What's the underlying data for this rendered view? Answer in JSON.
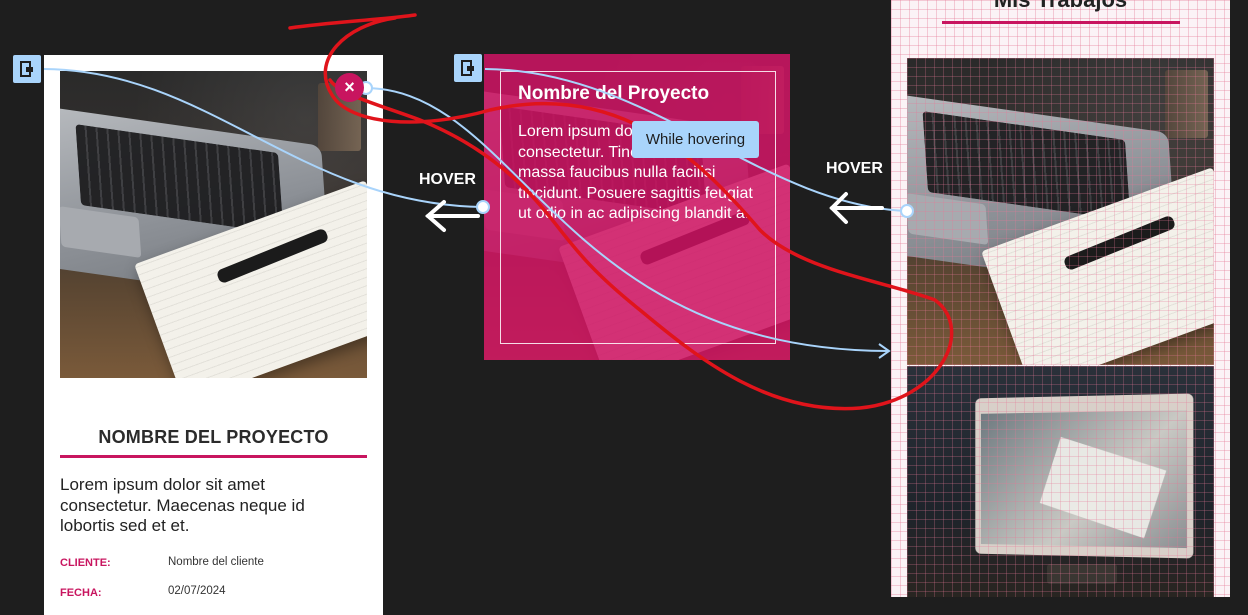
{
  "detail_card": {
    "title": "NOMBRE DEL PROYECTO",
    "description": "Lorem ipsum dolor sit amet consectetur. Maecenas neque id lobortis sed et et.",
    "meta": [
      {
        "label": "CLIENTE:",
        "value": "Nombre del cliente"
      },
      {
        "label": "FECHA:",
        "value": "02/07/2024"
      }
    ]
  },
  "hover_card": {
    "title": "Nombre del Proyecto",
    "description": "Lorem ipsum dolor sit amet consectetur. Tincidunt habitant massa faucibus nulla facilisi tincidunt. Posuere sagittis feugiat ut odio in ac adipiscing blandit a."
  },
  "page": {
    "title": "Mis Trabajos"
  },
  "prototype": {
    "hover_label_left": "HOVER",
    "hover_label_right": "HOVER",
    "tooltip": "While hovering",
    "close_glyph": "×"
  },
  "icons": {
    "frame_handle": "frame-link-icon",
    "arrow": "arrow-left-icon",
    "close": "close-icon"
  },
  "colors": {
    "canvas": "#1e1e1e",
    "brand": "#c8155f",
    "connector": "#a9d4fb",
    "annotation": "#e0141b"
  }
}
